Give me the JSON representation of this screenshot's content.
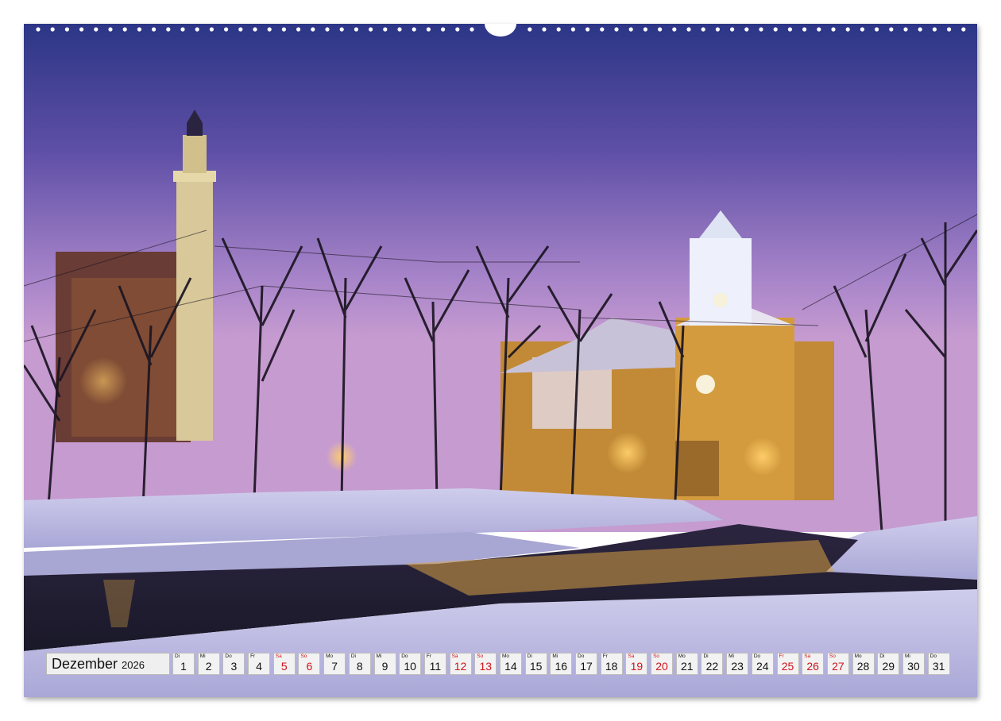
{
  "calendar": {
    "month": "Dezember",
    "year": "2026",
    "accent_color": "#d0141a",
    "days": [
      {
        "wd": "Di",
        "num": "1",
        "weekend": false
      },
      {
        "wd": "Mi",
        "num": "2",
        "weekend": false
      },
      {
        "wd": "Do",
        "num": "3",
        "weekend": false
      },
      {
        "wd": "Fr",
        "num": "4",
        "weekend": false
      },
      {
        "wd": "Sa",
        "num": "5",
        "weekend": true
      },
      {
        "wd": "So",
        "num": "6",
        "weekend": true
      },
      {
        "wd": "Mo",
        "num": "7",
        "weekend": false
      },
      {
        "wd": "Di",
        "num": "8",
        "weekend": false
      },
      {
        "wd": "Mi",
        "num": "9",
        "weekend": false
      },
      {
        "wd": "Do",
        "num": "10",
        "weekend": false
      },
      {
        "wd": "Fr",
        "num": "11",
        "weekend": false
      },
      {
        "wd": "Sa",
        "num": "12",
        "weekend": true
      },
      {
        "wd": "So",
        "num": "13",
        "weekend": true
      },
      {
        "wd": "Mo",
        "num": "14",
        "weekend": false
      },
      {
        "wd": "Di",
        "num": "15",
        "weekend": false
      },
      {
        "wd": "Mi",
        "num": "16",
        "weekend": false
      },
      {
        "wd": "Do",
        "num": "17",
        "weekend": false
      },
      {
        "wd": "Fr",
        "num": "18",
        "weekend": false
      },
      {
        "wd": "Sa",
        "num": "19",
        "weekend": true
      },
      {
        "wd": "So",
        "num": "20",
        "weekend": true
      },
      {
        "wd": "Mo",
        "num": "21",
        "weekend": false
      },
      {
        "wd": "Di",
        "num": "22",
        "weekend": false
      },
      {
        "wd": "Mi",
        "num": "23",
        "weekend": false
      },
      {
        "wd": "Do",
        "num": "24",
        "weekend": false
      },
      {
        "wd": "Fr",
        "num": "25",
        "weekend": true
      },
      {
        "wd": "Sa",
        "num": "26",
        "weekend": true
      },
      {
        "wd": "So",
        "num": "27",
        "weekend": true
      },
      {
        "wd": "Mo",
        "num": "28",
        "weekend": false
      },
      {
        "wd": "Di",
        "num": "29",
        "weekend": false
      },
      {
        "wd": "Mi",
        "num": "30",
        "weekend": false
      },
      {
        "wd": "Do",
        "num": "31",
        "weekend": false
      }
    ]
  },
  "photo": {
    "subject": "night-river-scene-with-tower-and-domed-building",
    "sky_top": "#2f3a8a",
    "sky_horizon": "#b68fd0",
    "snow_color": "#d9d8f2",
    "light_color": "#f5b740"
  }
}
